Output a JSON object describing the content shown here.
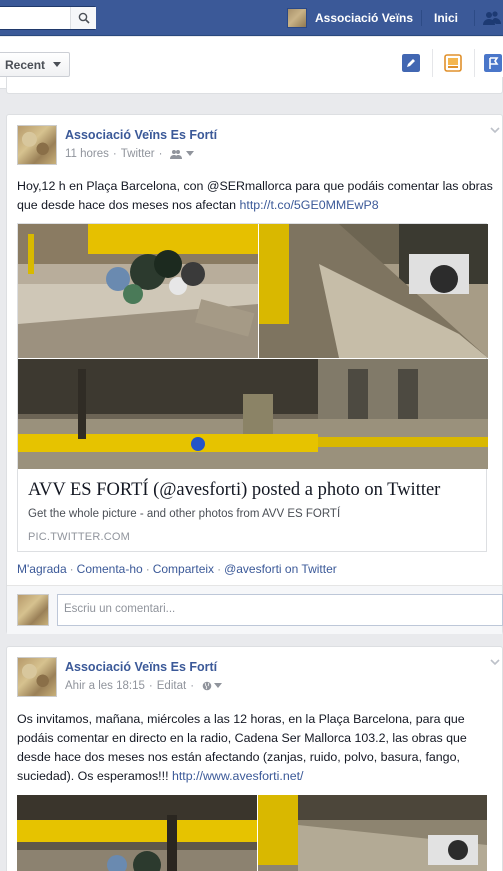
{
  "topbar": {
    "profile_name": "Associació Veïns",
    "home_label": "Inici"
  },
  "toolbar": {
    "recent_label": "Recent"
  },
  "post1": {
    "author": "Associació Veïns Es Fortí",
    "time": "11 hores",
    "source": "Twitter",
    "text_before_link": "Hoy,12 h en Plaça Barcelona, con @SERmallorca para que podáis comentar las obras que desde hace dos meses nos afectan ",
    "link": "http://t.co/5GE0MMEwP8",
    "attachment_title": "AVV ES FORTÍ (@avesforti) posted a photo on Twitter",
    "attachment_subtitle": "Get the whole picture - and other photos from AVV ES FORTÍ",
    "attachment_source": "PIC.TWITTER.COM",
    "actions": {
      "like": "M'agrada",
      "comment": "Comenta-ho",
      "share": "Comparteix",
      "via": "@avesforti on Twitter"
    },
    "comment_placeholder": "Escriu un comentari..."
  },
  "post2": {
    "author": "Associació Veïns Es Fortí",
    "time": "Ahir a les 18:15",
    "edited": "Editat",
    "text_before_link": "Os invitamos, mañana, miércoles a las 12 horas, en la Plaça Barcelona, para que podáis comentar en directo en la radio, Cadena Ser Mallorca 103.2, las obras que desde hace dos meses nos están afectando (zanjas, ruido, polvo, basura, fango, suciedad). Os esperamos!!! ",
    "link": "http://www.avesforti.net/"
  },
  "colors": {
    "brand_blue": "#3b5998",
    "link_blue": "#3b5998",
    "meta_gray": "#90949c",
    "barrier_yellow": "#f2c500"
  }
}
